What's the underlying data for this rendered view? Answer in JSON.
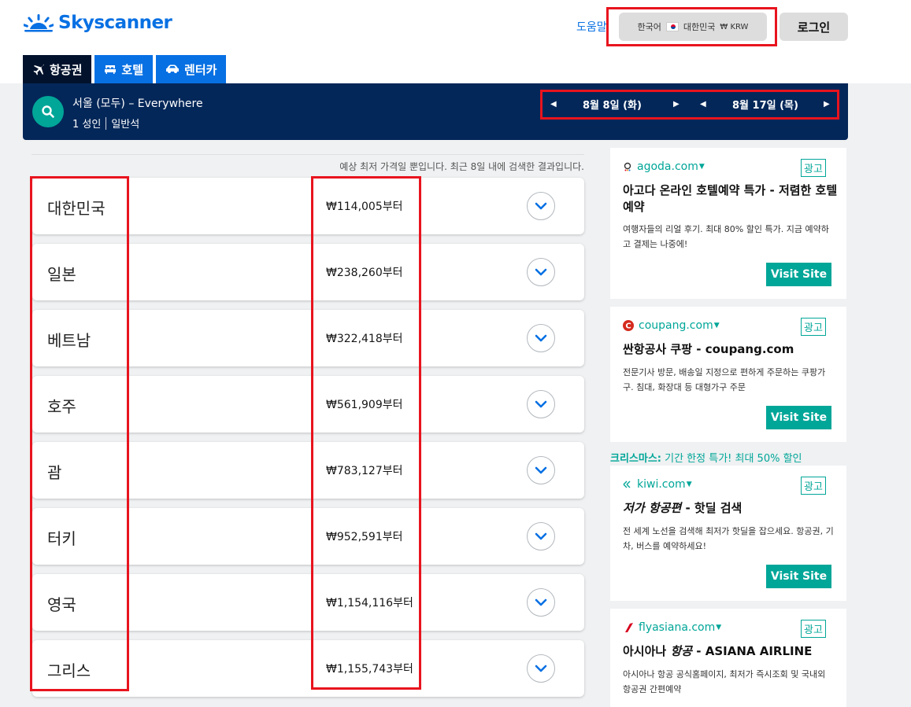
{
  "header": {
    "logo_text": "Skyscanner",
    "help": "도움말",
    "locale": {
      "language": "한국어",
      "region": "대한민국",
      "currency": "₩ KRW"
    },
    "login": "로그인"
  },
  "tabs": [
    {
      "label": "항공권",
      "icon": "plane-icon",
      "active": true
    },
    {
      "label": "호텔",
      "icon": "bed-icon",
      "active": false
    },
    {
      "label": "렌터카",
      "icon": "car-icon",
      "active": false
    }
  ],
  "search": {
    "route": "서울 (모두) – Everywhere",
    "passengers": "1 성인",
    "cabin": "일반석",
    "depart_date": "8월 8일 (화)",
    "return_date": "8월 17일 (목)"
  },
  "results": {
    "disclaimer": "예상 최저 가격일 뿐입니다. 최근 8일 내에 검색한 결과입니다.",
    "items": [
      {
        "country": "대한민국",
        "price": "₩114,005부터"
      },
      {
        "country": "일본",
        "price": "₩238,260부터"
      },
      {
        "country": "베트남",
        "price": "₩322,418부터"
      },
      {
        "country": "호주",
        "price": "₩561,909부터"
      },
      {
        "country": "괌",
        "price": "₩783,127부터"
      },
      {
        "country": "터키",
        "price": "₩952,591부터"
      },
      {
        "country": "영국",
        "price": "₩1,154,116부터"
      },
      {
        "country": "그리스",
        "price": "₩1,155,743부터"
      }
    ]
  },
  "ads": [
    {
      "domain": "agoda.com",
      "badge": "광고",
      "title": "아고다 온라인 호텔예약 특가 - 저렴한 호텔 예약",
      "desc": "여행자들의 리얼 후기. 최대 80% 할인 특가. 지금 예약하고 결제는 나중에!",
      "cta": "Visit Site"
    },
    {
      "domain": "coupang.com",
      "badge": "광고",
      "title": "싼항공사 쿠팡 - coupang.com",
      "desc": "전문기사 방문, 배송일 지정으로 편하게 주문하는 쿠팡가구. 침대, 화장대 등 대형가구 주문",
      "cta": "Visit Site"
    },
    {
      "promo_label": "크리스마스:",
      "promo_text": " 기간 한정 특가! 최대 50% 할인",
      "domain": "kiwi.com",
      "badge": "광고",
      "title_italic": "저가 항공편",
      "title_rest": " - 핫딜 검색",
      "desc": "전 세계 노선을 검색해 최저가 핫딜을 잡으세요. 항공권, 기차, 버스를 예약하세요!",
      "cta": "Visit Site"
    },
    {
      "domain": "flyasiana.com",
      "badge": "광고",
      "title_a": "아시아나 ",
      "title_italic": "항공",
      "title_rest": " - ASIANA AIRLINE",
      "desc": "아시아나 항공 공식홈페이지, 최저가 즉시조회 및 국내외 항공권 간편예약"
    }
  ],
  "colors": {
    "brand_blue": "#0770e3",
    "navy": "#042759",
    "teal": "#00a698",
    "highlight_red": "#e8141e"
  }
}
